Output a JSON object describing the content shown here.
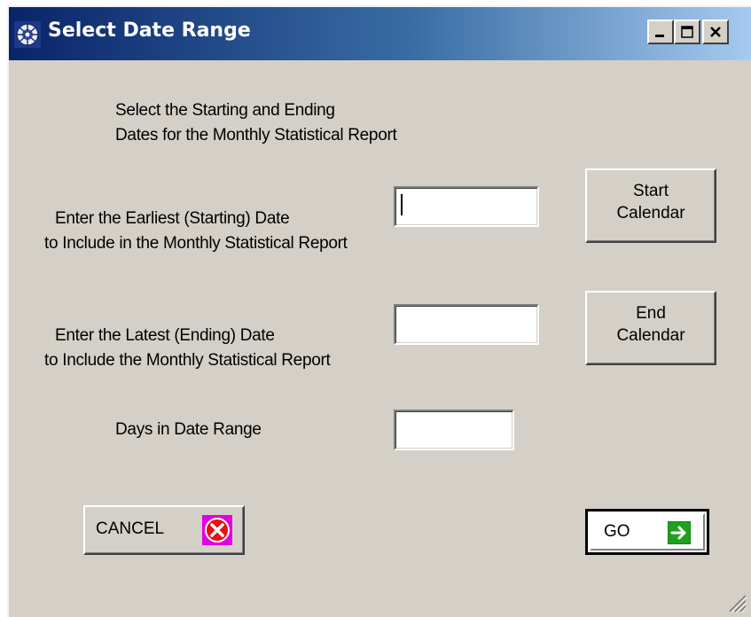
{
  "window": {
    "title": "Select Date Range",
    "title_icon": "app-globe-icon",
    "controls": {
      "minimize_icon": "minimize-icon",
      "maximize_icon": "maximize-icon",
      "close_icon": "close-icon"
    }
  },
  "instructions": {
    "line1": "Select the Starting and Ending",
    "line2": "Dates for the Monthly Statistical Report"
  },
  "start_date": {
    "label_line1": "Enter the Earliest (Starting) Date",
    "label_line2": "to Include in the Monthly Statistical Report",
    "value": "",
    "button_line1": "Start",
    "button_line2": "Calendar"
  },
  "end_date": {
    "label_line1": "Enter the Latest (Ending) Date",
    "label_line2": "to Include the Monthly Statistical Report",
    "value": "",
    "button_line1": "End",
    "button_line2": "Calendar"
  },
  "days": {
    "label": "Days in Date Range",
    "value": ""
  },
  "actions": {
    "cancel_label": "CANCEL",
    "cancel_icon": "red-x-circle-icon",
    "go_label": "GO",
    "go_icon": "green-arrow-right-icon"
  },
  "colors": {
    "dialog_background": "#d4d0c8",
    "titlebar_start": "#0a246a",
    "titlebar_end": "#a6caf0",
    "cancel_icon_bg": "#e000e0",
    "cancel_icon_circle": "#e81010",
    "go_icon_bg": "#20a020"
  }
}
